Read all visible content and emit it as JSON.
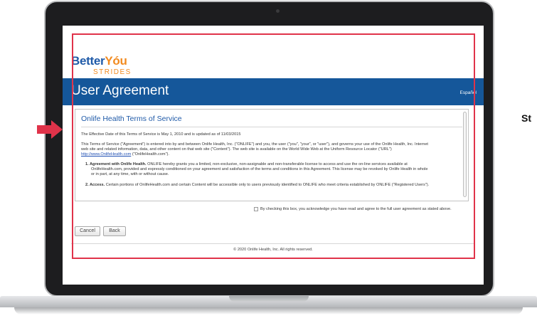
{
  "brand": {
    "name_part1": "Better",
    "name_part2": "Yóu",
    "tagline": "STRIDES",
    "colors": {
      "blue": "#1f5aa8",
      "orange": "#f28b20",
      "header": "#15579a",
      "annotation": "#e0334a"
    }
  },
  "header": {
    "title": "User Agreement",
    "language_link": "Español"
  },
  "terms": {
    "title": "Onlife Health Terms of Service",
    "effective": "The Effective Date of this Terms of Service is May 1, 2010 and is updated as of 11/03/2015",
    "intro_1": "This Terms of Service (\"Agreement\") is entered into by and between Onlife Health, Inc. (\"ONLIFE\") and you, the user (\"you\", \"your\", or \"user\"), and governs your use of the Onlife Health, Inc. Internet",
    "intro_2": "web site and related information, data, and other content on that web site (\"Content\"). The web site is available on the World Wide Web at the Uniform Resource Locator (\"URL\")",
    "intro_3_link": "http://www.OnlifeHealth.com",
    "intro_3_rest": " (\"OnlifeHealth.com\").",
    "item1_label": "1. Agreement with Onlife Health.",
    "item1_line1": " ONLIFE hereby grants you a limited, non-exclusive, non-assignable and non-transferable license to access and use the on-line services available at",
    "item1_line2": "OnlifeHealth.com, provided and expressly conditioned on your agreement and satisfaction of the terms and conditions in this Agreement. This license may be revoked by Onlife Health in whole",
    "item1_line3": "or in part, at any time, with or without cause.",
    "item2_label": "2. Access.",
    "item2_line1": " Certain portions of OnlifeHealth.com and certain Content will be accessible only to users previously identified to ONLIFE who meet criteria established by ONLIFE (\"Registered Users\")."
  },
  "acknowledgement": {
    "checked": false,
    "label": "By checking this box, you acknowledge you have read and agree to the full user agreement as stated above."
  },
  "buttons": {
    "cancel": "Cancel",
    "back": "Back"
  },
  "footer": {
    "copyright": "© 2020 Onlife Health, Inc. All rights reserved."
  },
  "annotation": {
    "cut_text": "St"
  }
}
